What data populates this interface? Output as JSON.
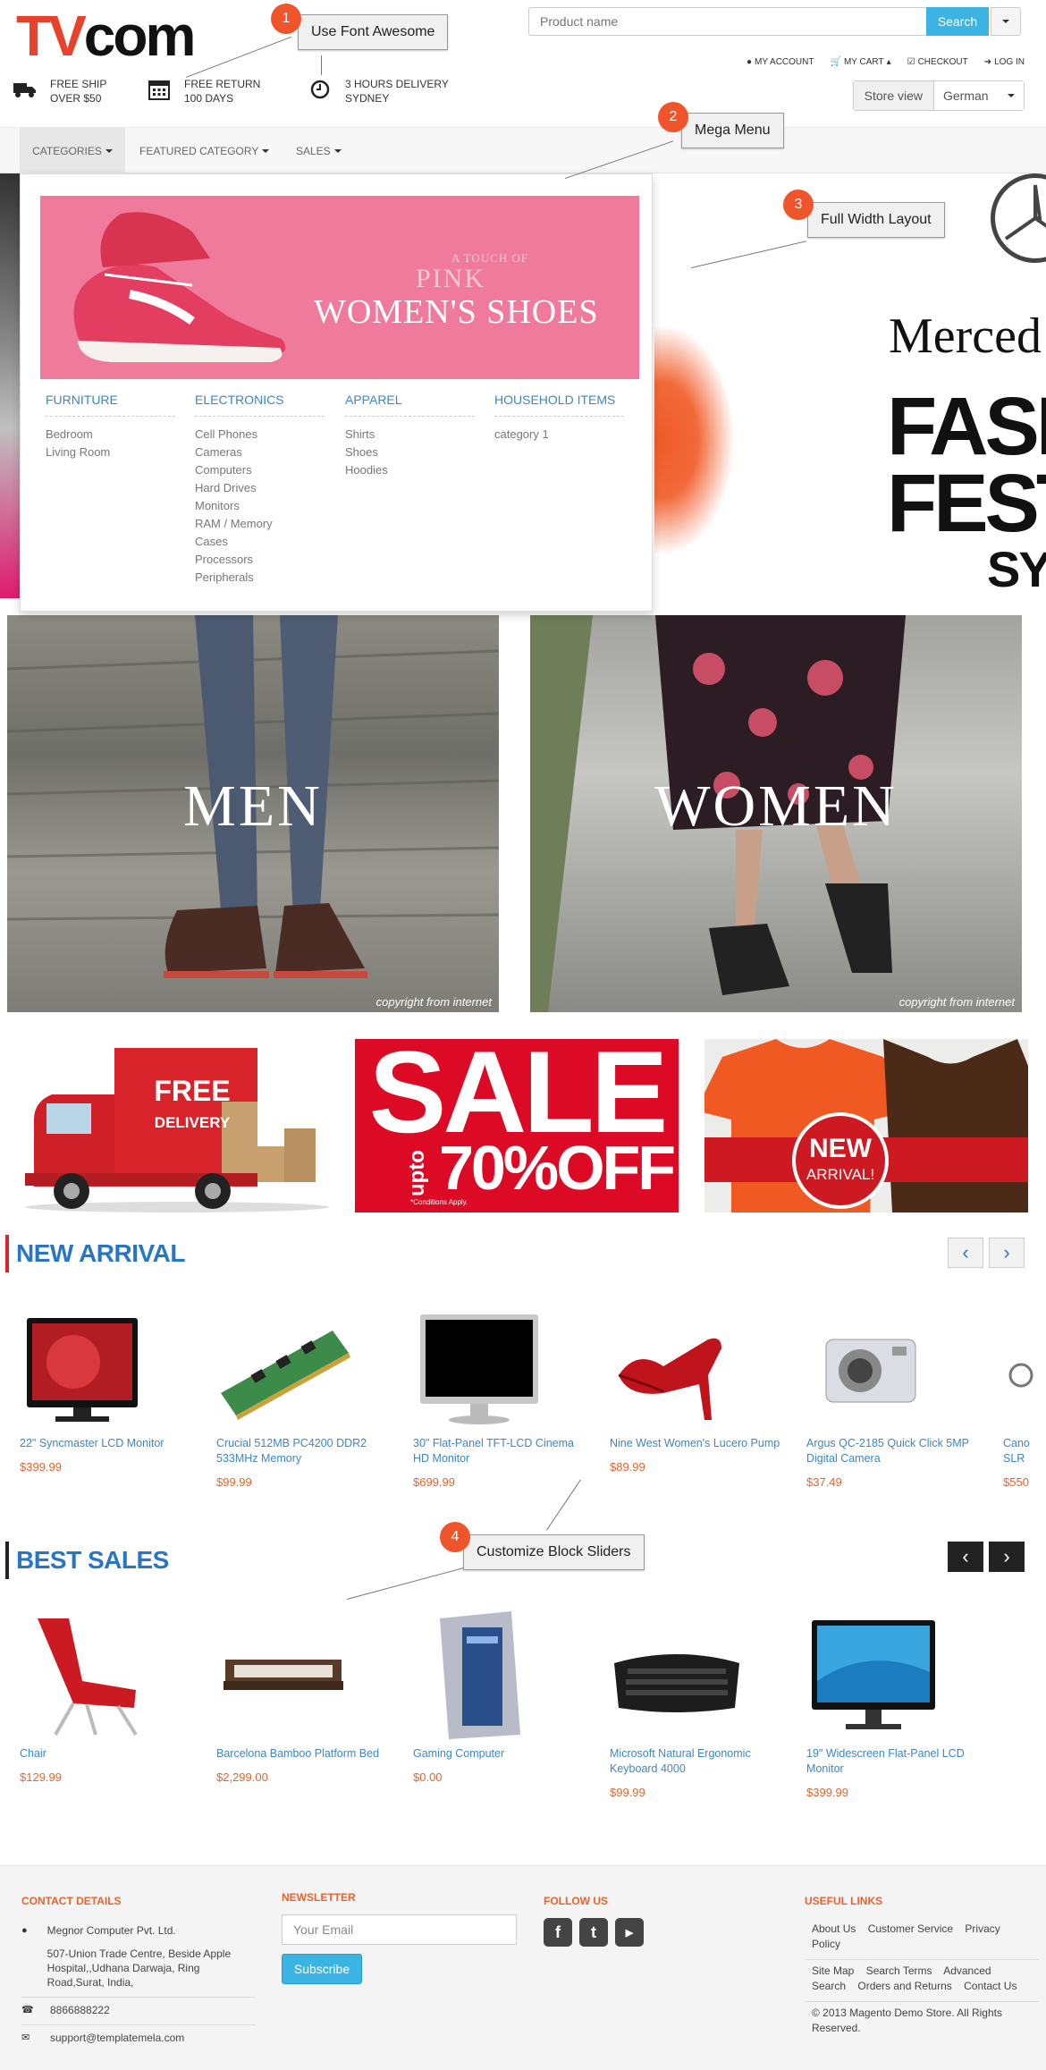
{
  "header": {
    "logo_tv": "TV",
    "logo_com": "com",
    "search_placeholder": "Product name",
    "search_button": "Search",
    "toplinks": {
      "account": "MY ACCOUNT",
      "cart": "MY CART",
      "checkout": "CHECKOUT",
      "login": "LOG IN"
    },
    "features": [
      {
        "line1": "FREE SHIP",
        "line2": "OVER $50",
        "icon": "truck-icon"
      },
      {
        "line1": "FREE RETURN",
        "line2": "100 DAYS",
        "icon": "calendar-icon"
      },
      {
        "line1": "3 HOURS DELIVERY",
        "line2": "SYDNEY",
        "icon": "clock-icon"
      }
    ],
    "store_view_label": "Store view",
    "store_view_value": "German"
  },
  "nav": {
    "categories": "CATEGORIES",
    "featured": "FEATURED CATEGORY",
    "sales": "SALES"
  },
  "mega_menu": {
    "banner_line1": "A TOUCH OF",
    "banner_line2": "PINK",
    "banner_line3": "WOMEN'S SHOES",
    "columns": [
      {
        "title": "FURNITURE",
        "links": [
          "Bedroom",
          "Living Room"
        ]
      },
      {
        "title": "ELECTRONICS",
        "links": [
          "Cell Phones",
          "Cameras",
          "Computers",
          "Hard Drives",
          "Monitors",
          "RAM / Memory",
          "Cases",
          "Processors",
          "Peripherals"
        ]
      },
      {
        "title": "APPAREL",
        "links": [
          "Shirts",
          "Shoes",
          "Hoodies"
        ]
      },
      {
        "title": "HOUSEHOLD ITEMS",
        "links": [
          "category 1"
        ]
      }
    ]
  },
  "hero": {
    "brand_text": "Merced",
    "fash1": "FASH",
    "fash2": "FEST",
    "city": "SYD"
  },
  "callouts": [
    {
      "num": "1",
      "label": "Use Font Awesome"
    },
    {
      "num": "2",
      "label": "Mega Menu"
    },
    {
      "num": "3",
      "label": "Full Width Layout"
    },
    {
      "num": "4",
      "label": "Customize Block Sliders"
    }
  ],
  "banners": {
    "men": "MEN",
    "women": "WOMEN",
    "copyright": "copyright from internet"
  },
  "promos": {
    "delivery_line1": "FREE",
    "delivery_line2": "DELIVERY",
    "sale": "SALE",
    "upto": "upto",
    "off": "70%OFF",
    "conditions": "*Conditions Apply.",
    "new1": "NEW",
    "new2": "ARRIVAL!"
  },
  "new_arrival": {
    "title": "NEW ARRIVAL",
    "products": [
      {
        "name": "22\" Syncmaster LCD Monitor",
        "price": "$399.99"
      },
      {
        "name": "Crucial 512MB PC4200 DDR2 533MHz Memory",
        "price": "$99.99"
      },
      {
        "name": "30\" Flat-Panel TFT-LCD Cinema HD Monitor",
        "price": "$699.99"
      },
      {
        "name": "Nine West Women's Lucero Pump",
        "price": "$89.99"
      },
      {
        "name": "Argus QC-2185 Quick Click 5MP Digital Camera",
        "price": "$37.49"
      },
      {
        "name": "Cano SLR",
        "price": "$550"
      }
    ]
  },
  "best_sales": {
    "title": "BEST SALES",
    "products": [
      {
        "name": "Chair",
        "price": "$129.99"
      },
      {
        "name": "Barcelona Bamboo Platform Bed",
        "price": "$2,299.00"
      },
      {
        "name": "Gaming Computer",
        "price": "$0.00"
      },
      {
        "name": "Microsoft Natural Ergonomic Keyboard 4000",
        "price": "$99.99"
      },
      {
        "name": "19\" Widescreen Flat-Panel LCD Monitor",
        "price": "$399.99"
      }
    ]
  },
  "footer": {
    "contact_title": "CONTACT DETAILS",
    "company": "Megnor Computer Pvt. Ltd.",
    "address": "507-Union Trade Centre, Beside Apple Hospital,,Udhana Darwaja, Ring Road,Surat, India,",
    "phone": "8866888222",
    "email": "support@templatemela.com",
    "newsletter_title": "NEWSLETTER",
    "newsletter_placeholder": "Your Email",
    "subscribe": "Subscribe",
    "follow_title": "FOLLOW US",
    "useful_title": "USEFUL LINKS",
    "links_group1": [
      "About Us",
      "Customer Service",
      "Privacy Policy"
    ],
    "links_group2": [
      "Site Map",
      "Search Terms",
      "Advanced Search",
      "Orders and Returns",
      "Contact Us"
    ],
    "copyright": "© 2013 Magento Demo Store. All Rights Reserved."
  }
}
